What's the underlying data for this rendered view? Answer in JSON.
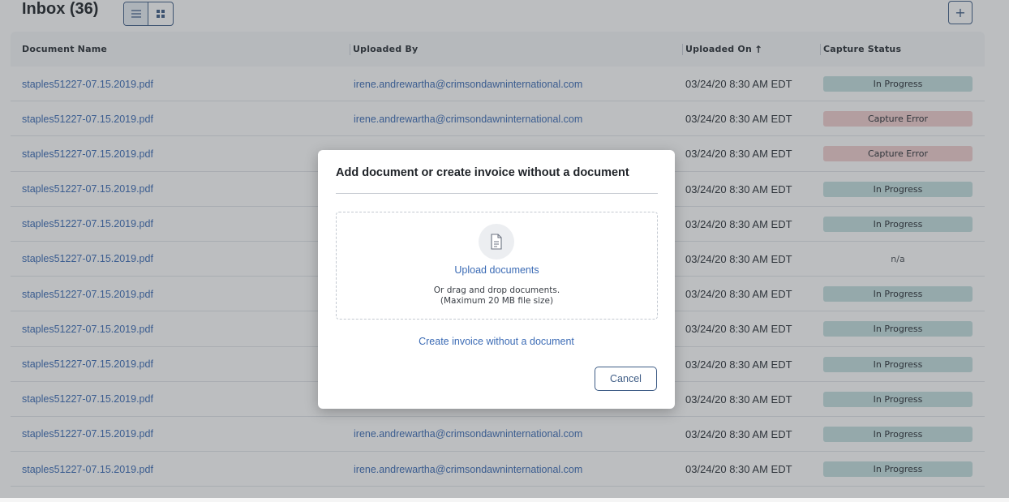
{
  "header": {
    "title": "Inbox (36)",
    "list_view_icon": "list-icon",
    "grid_view_icon": "grid-icon",
    "add_label": "+"
  },
  "table": {
    "columns": [
      "Document Name",
      "Uploaded By",
      "Uploaded On",
      "Capture Status"
    ],
    "sort_indicator": "↑",
    "rows": [
      {
        "name": "staples51227-07.15.2019.pdf",
        "by": "irene.andrewartha@crimsondawninternational.com",
        "on": "03/24/20 8:30 AM EDT",
        "status": "In Progress"
      },
      {
        "name": "staples51227-07.15.2019.pdf",
        "by": "irene.andrewartha@crimsondawninternational.com",
        "on": "03/24/20 8:30 AM EDT",
        "status": "Capture Error"
      },
      {
        "name": "staples51227-07.15.2019.pdf",
        "by": "",
        "on": "03/24/20 8:30 AM EDT",
        "status": "Capture Error"
      },
      {
        "name": "staples51227-07.15.2019.pdf",
        "by": "",
        "on": "03/24/20 8:30 AM EDT",
        "status": "In Progress"
      },
      {
        "name": "staples51227-07.15.2019.pdf",
        "by": "",
        "on": "03/24/20 8:30 AM EDT",
        "status": "In Progress"
      },
      {
        "name": "staples51227-07.15.2019.pdf",
        "by": "",
        "on": "03/24/20 8:30 AM EDT",
        "status": "n/a"
      },
      {
        "name": "staples51227-07.15.2019.pdf",
        "by": "",
        "on": "03/24/20 8:30 AM EDT",
        "status": "In Progress"
      },
      {
        "name": "staples51227-07.15.2019.pdf",
        "by": "",
        "on": "03/24/20 8:30 AM EDT",
        "status": "In Progress"
      },
      {
        "name": "staples51227-07.15.2019.pdf",
        "by": "",
        "on": "03/24/20 8:30 AM EDT",
        "status": "In Progress"
      },
      {
        "name": "staples51227-07.15.2019.pdf",
        "by": "",
        "on": "03/24/20 8:30 AM EDT",
        "status": "In Progress"
      },
      {
        "name": "staples51227-07.15.2019.pdf",
        "by": "irene.andrewartha@crimsondawninternational.com",
        "on": "03/24/20 8:30 AM EDT",
        "status": "In Progress"
      },
      {
        "name": "staples51227-07.15.2019.pdf",
        "by": "irene.andrewartha@crimsondawninternational.com",
        "on": "03/24/20 8:30 AM EDT",
        "status": "In Progress"
      }
    ]
  },
  "status_colors": {
    "In Progress": "#c4dfe0",
    "Capture Error": "#f2cfcf",
    "n/a": "transparent"
  },
  "modal": {
    "title": "Add document or create invoice without a document",
    "upload_icon": "document-icon",
    "upload_label": "Upload documents",
    "drag_line1": "Or drag and drop documents.",
    "drag_line2": "(Maximum 20 MB file size)",
    "create_label": "Create invoice without a document",
    "cancel_label": "Cancel"
  }
}
